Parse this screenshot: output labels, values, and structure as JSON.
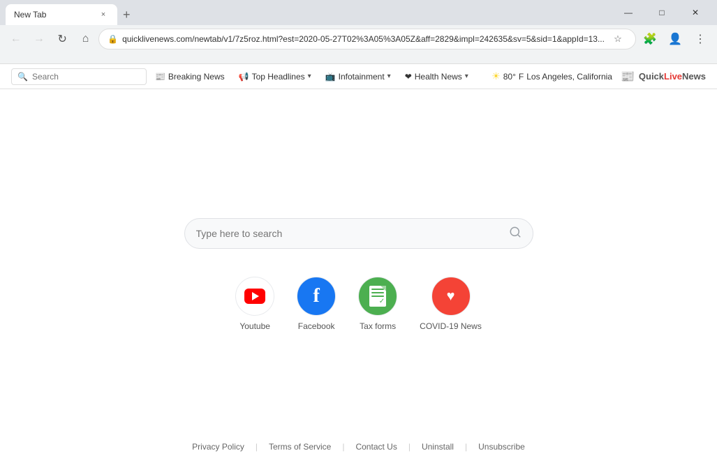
{
  "browser": {
    "tab": {
      "title": "New Tab",
      "close_label": "×"
    },
    "new_tab_btn": "+",
    "window_controls": {
      "minimize": "—",
      "maximize": "□",
      "close": "✕"
    },
    "nav": {
      "back": "←",
      "forward": "→",
      "refresh": "↻",
      "home": "⌂",
      "address": "quicklivenews.com/newtab/v1/7z5roz.html?est=2020-05-27T02%3A05%3A05Z&aff=2829&impl=242635&sv=5&sid=1&appId=13...",
      "bookmark": "☆",
      "extensions": "🧩",
      "profile": "👤",
      "menu": "⋮"
    }
  },
  "newsbar": {
    "search_placeholder": "Search",
    "breaking_news_label": "Breaking News",
    "top_headlines_label": "Top Headlines",
    "infotainment_label": "Infotainment",
    "health_news_label": "Health News",
    "weather": {
      "temp": "80°",
      "unit": "F",
      "location": "Los Angeles, California",
      "icon": "☀"
    },
    "brand": {
      "quick": "Quick",
      "live": "Live",
      "news": "News"
    }
  },
  "main": {
    "search_placeholder": "Type here to search",
    "search_icon": "🔍",
    "quick_links": [
      {
        "id": "youtube",
        "label": "Youtube",
        "type": "youtube"
      },
      {
        "id": "facebook",
        "label": "Facebook",
        "type": "facebook"
      },
      {
        "id": "tax-forms",
        "label": "Tax forms",
        "type": "tax"
      },
      {
        "id": "covid-news",
        "label": "COVID-19 News",
        "type": "covid"
      }
    ]
  },
  "footer": {
    "links": [
      {
        "label": "Privacy Policy"
      },
      {
        "label": "Terms of Service"
      },
      {
        "label": "Contact Us"
      },
      {
        "label": "Uninstall"
      },
      {
        "label": "Unsubscribe"
      }
    ]
  }
}
